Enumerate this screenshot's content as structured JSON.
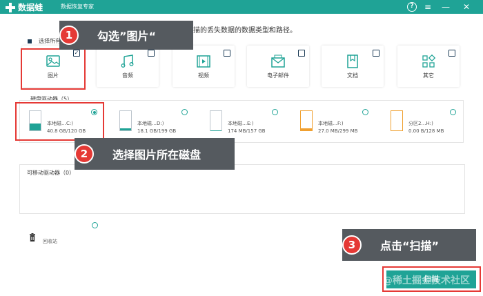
{
  "window": {
    "app_name": "数据蛙",
    "subtitle": "数据恢复专家",
    "controls": {
      "help": "?",
      "menu": "≡",
      "minimize": "—",
      "close": "✕"
    }
  },
  "instruction": "选择要扫描的丢失数据的数据类型和路径。",
  "select_all_label": "选择所有文件类型",
  "categories": [
    {
      "label": "图片",
      "icon": "image-icon",
      "checked": true
    },
    {
      "label": "音频",
      "icon": "audio-icon",
      "checked": false
    },
    {
      "label": "视频",
      "icon": "video-icon",
      "checked": false
    },
    {
      "label": "电子邮件",
      "icon": "email-icon",
      "checked": false
    },
    {
      "label": "文档",
      "icon": "document-icon",
      "checked": false
    },
    {
      "label": "其它",
      "icon": "other-icon",
      "checked": false
    }
  ],
  "hard_drives": {
    "label": "硬盘驱动器（5）",
    "drives": [
      {
        "name": "本地磁…C:)",
        "size": "40.8 GB/120 GB",
        "fill_pct": 34,
        "color": "#1fa396",
        "selected": true
      },
      {
        "name": "本地磁…D:)",
        "size": "18.1 GB/199 GB",
        "fill_pct": 9,
        "color": "#1fa396",
        "selected": false
      },
      {
        "name": "本地磁…E:)",
        "size": "174 MB/157 GB",
        "fill_pct": 1,
        "color": "#1fa396",
        "selected": false
      },
      {
        "name": "本地磁…F:)",
        "size": "27.0 MB/299 MB",
        "fill_pct": 9,
        "color": "#f0a030",
        "selected": false
      },
      {
        "name": "分区2…H:)",
        "size": "0.00  B/128 MB",
        "fill_pct": 0,
        "color": "#f0a030",
        "selected": false
      }
    ]
  },
  "removable": {
    "label": "可移动驱动器（0）"
  },
  "recycle_bin": {
    "label": "回收站"
  },
  "scan_button": "扫描",
  "callouts": [
    {
      "num": "1",
      "text": "勾选”图片“"
    },
    {
      "num": "2",
      "text": "选择图片所在磁盘"
    },
    {
      "num": "3",
      "text": "点击“扫描”"
    }
  ],
  "watermark": "@稀土掘金技术社区",
  "colors": {
    "accent": "#1fa396",
    "highlight": "#e53935",
    "callout_bg": "#555a5f"
  }
}
